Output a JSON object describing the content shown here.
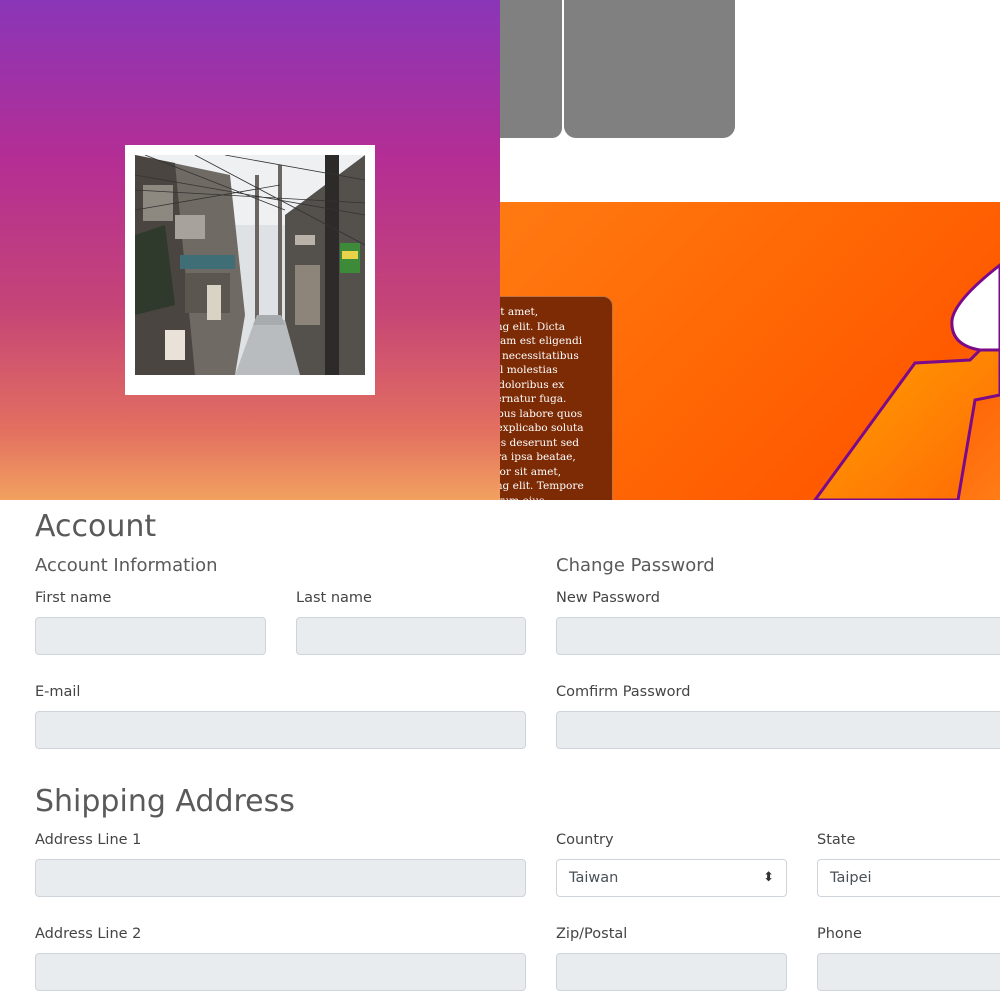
{
  "hero": {
    "lorem_lines": [
      "r sit amet,",
      "icing elit. Dicta",
      "ignam est eligendi",
      "iis, necessitatibus",
      "iihil molestias",
      "ur doloribus ex",
      "spernatur fuga.",
      "atibus labore quos",
      "m explicabo soluta",
      "ores deserunt sed",
      "pora ipsa beatae,",
      "dolor sit amet,",
      "icing elit. Tempore",
      "Rerum eius"
    ],
    "colors": {
      "gradient_top": "#8a36b8",
      "gradient_bottom": "#f2a160",
      "orange": "#ff6a06",
      "outline": "#7b0a8a",
      "card_gray": "#808080",
      "text_card": "#7c2b05"
    }
  },
  "account": {
    "title": "Account",
    "info_heading": "Account Information",
    "first_name_label": "First name",
    "last_name_label": "Last name",
    "email_label": "E-mail",
    "password_heading": "Change Password",
    "new_password_label": "New Password",
    "confirm_password_label": "Comfirm Password"
  },
  "shipping": {
    "title": "Shipping Address",
    "address1_label": "Address Line 1",
    "address2_label": "Address Line 2",
    "country_label": "Country",
    "country_value": "Taiwan",
    "state_label": "State",
    "state_value": "Taipei",
    "zip_label": "Zip/Postal",
    "phone_label": "Phone"
  },
  "icons": {
    "select_caret": "select-caret-icon"
  }
}
